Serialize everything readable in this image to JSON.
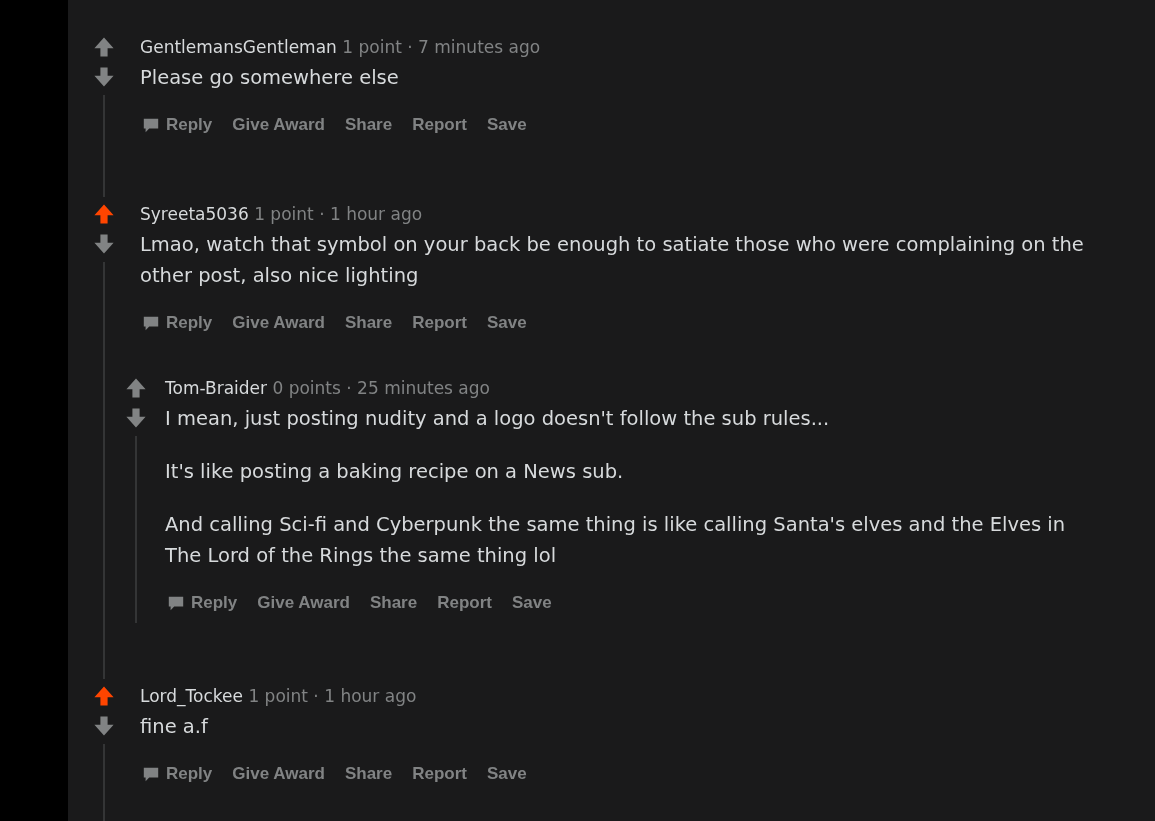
{
  "comments": [
    {
      "author": "GentlemansGentleman",
      "points": "1 point",
      "separator": "·",
      "time": "7 minutes ago",
      "upvoted": false,
      "paragraphs": [
        "Please go somewhere else"
      ],
      "actions": [
        "Reply",
        "Give Award",
        "Share",
        "Report",
        "Save"
      ]
    },
    {
      "author": "Syreeta5036",
      "points": "1 point",
      "separator": "·",
      "time": "1 hour ago",
      "upvoted": true,
      "paragraphs": [
        "Lmao, watch that symbol on your back be enough to satiate those who were complaining on the other post, also nice lighting"
      ],
      "actions": [
        "Reply",
        "Give Award",
        "Share",
        "Report",
        "Save"
      ],
      "children": [
        {
          "author": "Tom-Braider",
          "points": "0 points",
          "separator": "·",
          "time": "25 minutes ago",
          "upvoted": false,
          "paragraphs": [
            "I mean, just posting nudity and a logo doesn't follow the sub rules...",
            "It's like posting a baking recipe on a News sub.",
            "And calling Sci-fi and Cyberpunk the same thing is like calling Santa's elves and the Elves in The Lord of the Rings the same thing lol"
          ],
          "actions": [
            "Reply",
            "Give Award",
            "Share",
            "Report",
            "Save"
          ]
        }
      ]
    },
    {
      "author": "Lord_Tockee",
      "points": "1 point",
      "separator": "·",
      "time": "1 hour ago",
      "upvoted": true,
      "paragraphs": [
        "fine a.f"
      ],
      "actions": [
        "Reply",
        "Give Award",
        "Share",
        "Report",
        "Save"
      ]
    }
  ]
}
